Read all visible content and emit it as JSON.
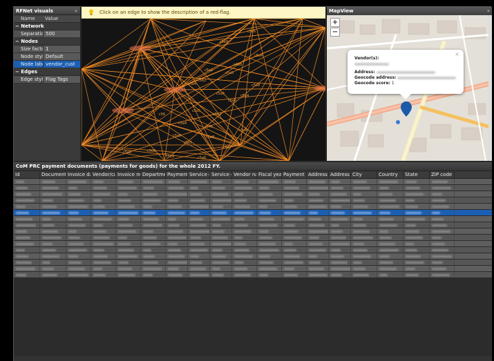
{
  "left_panel": {
    "title": "RFNet visuals",
    "collapse_icon": "«",
    "col_name": "Name",
    "col_value": "Value",
    "groups": [
      {
        "label": "− Network",
        "rows": [
          {
            "key": "Separation",
            "value": "500"
          }
        ]
      },
      {
        "label": "− Nodes",
        "rows": [
          {
            "key": "Size factor",
            "value": "1"
          },
          {
            "key": "Node style",
            "value": "Default"
          },
          {
            "key": "Node label",
            "value": "vendor_cust",
            "selected": true
          }
        ]
      },
      {
        "label": "− Edges",
        "rows": [
          {
            "key": "Edge style",
            "value": "Flag Tags"
          }
        ]
      }
    ]
  },
  "graph": {
    "hint": "Click on an edge to show the description of a red-flag.",
    "edge_labels": [
      "c5e6",
      "c5e8",
      "c5a4",
      "c4a8",
      "c5a2",
      "c5a5",
      "c5a8",
      "c5a4",
      "c562",
      "c5a5",
      "c5a4",
      "c5a6",
      "c5a5",
      "c5a2",
      "c56",
      "c5a4",
      "c545",
      "c5a5",
      "c5a6",
      "c5a8",
      "c5a5",
      "c568",
      "c5a8",
      "c5e9",
      "c5a6",
      "c5a7"
    ],
    "colors": {
      "edge": "#f08a24",
      "node": "#e07050",
      "label": "#f0a040"
    }
  },
  "map": {
    "title": "MapView",
    "more_icon": "»",
    "zoom_in": "+",
    "zoom_out": "−",
    "close_icon": "×",
    "popup": {
      "vendor_label": "Vendor(s):",
      "address_label": "Address:",
      "geocode_address_label": "Geocode address:",
      "geocode_score_label": "Geocode score:",
      "geocode_score_value": "1"
    }
  },
  "table": {
    "title": "CoM PRC payment documents (payments for goods) for the whole 2012 FY.",
    "columns": [
      "Id",
      "Document",
      "Invoice dat",
      "Vendor/cur",
      "Invoice nui",
      "Departmen",
      "Payment a",
      "Service di",
      "Service di",
      "Vendor nar",
      "Fiscal year",
      "Payment d",
      "Address li",
      "Address li",
      "City",
      "Country",
      "State",
      "ZIP code"
    ],
    "selected_row": 5,
    "row_count": 16
  }
}
